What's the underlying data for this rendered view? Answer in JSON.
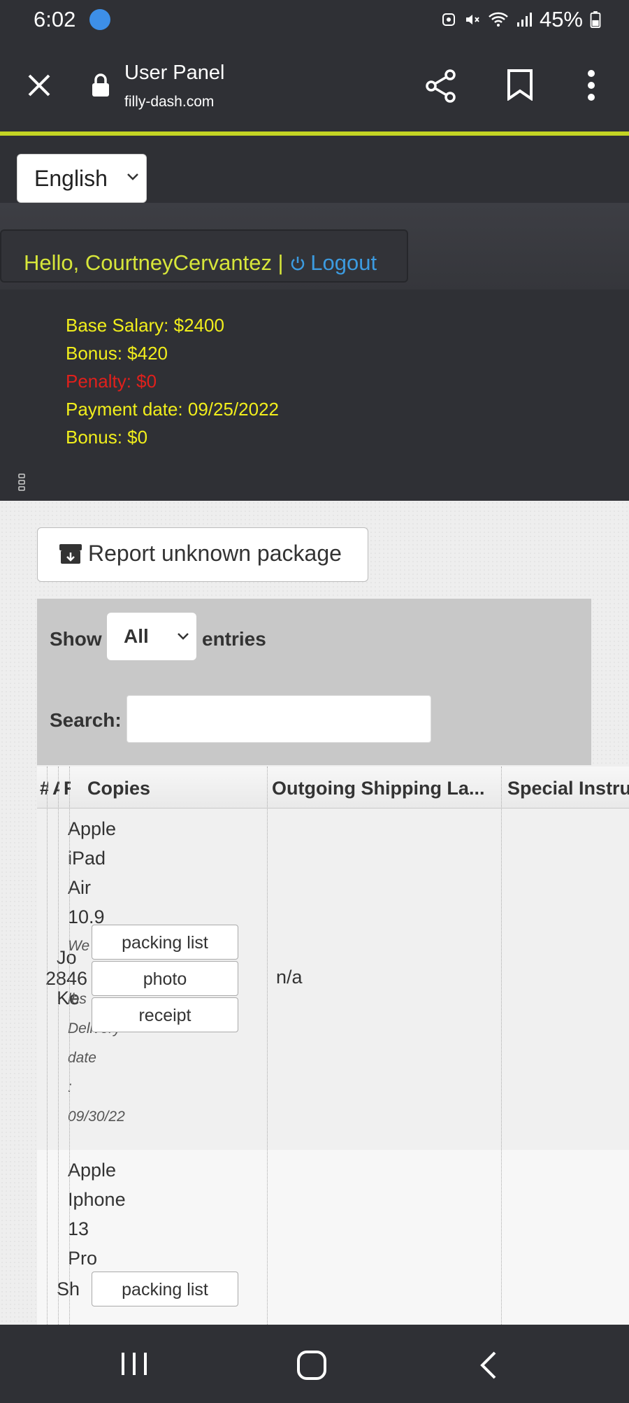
{
  "status": {
    "time": "6:02",
    "battery": "45%"
  },
  "browser": {
    "title": "User Panel",
    "url": "filly-dash.com"
  },
  "language": {
    "selected": "English"
  },
  "greeting": {
    "text": "Hello, CourtneyCervantez | ",
    "logout": "Logout"
  },
  "info": {
    "base_salary": "Base Salary: $2400",
    "bonus1": "Bonus: $420",
    "penalty": "Penalty: $0",
    "payment_date": "Payment date: 09/25/2022",
    "bonus2": "Bonus: $0"
  },
  "report_button": "Report unknown package",
  "controls": {
    "show": "Show",
    "entries_value": "All",
    "entries": "entries",
    "search": "Search:"
  },
  "table": {
    "headers": [
      "#",
      "A",
      "F",
      "Copies",
      "Outgoing Shipping La...",
      "Special Instru"
    ],
    "rows": [
      {
        "product_lines": [
          "Apple",
          "iPad",
          "Air",
          "10.9"
        ],
        "meta_lines": [
          "We",
          "lbs",
          "Delivery",
          "date",
          ":",
          "09/30/22"
        ],
        "frag_a": "Jo",
        "frag_b": "Ke",
        "frag_num": "2846",
        "buttons": [
          "packing list",
          "photo",
          "receipt"
        ],
        "shipping_label": "n/a"
      },
      {
        "product_lines": [
          "Apple",
          "Iphone",
          "13",
          "Pro"
        ],
        "frag_a": "Sh",
        "buttons": [
          "packing list"
        ]
      }
    ]
  },
  "colors": {
    "accent": "#c3d424",
    "greeting": "#d7e63a",
    "logout": "#3c9be0",
    "info": "#f1ee1c",
    "penalty": "#e0201c"
  }
}
